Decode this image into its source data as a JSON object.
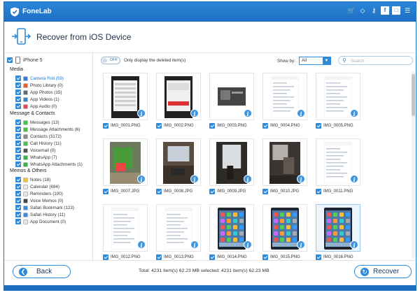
{
  "app": {
    "name": "FoneLab",
    "header_title": "Recover from iOS Device",
    "accent_color": "#2f8bd8",
    "titlebar_icons": [
      "cart-icon",
      "diamond-icon",
      "key-icon",
      "facebook-icon",
      "chat-icon",
      "menu-icon"
    ]
  },
  "sidebar": {
    "device": "iPhone 5",
    "sections": [
      {
        "title": "Media",
        "items": [
          {
            "label": "Camera Roll (59)",
            "color": "#3a7bd5",
            "active": true
          },
          {
            "label": "Photo Library (0)",
            "color": "#e0603a"
          },
          {
            "label": "App Photos (15)",
            "color": "#5a6b7d"
          },
          {
            "label": "App Videos (1)",
            "color": "#3f80c0"
          },
          {
            "label": "App Audio (0)",
            "color": "#e24b4b"
          }
        ]
      },
      {
        "title": "Message & Contacts",
        "items": [
          {
            "label": "Messages (13)",
            "color": "#4cc24c"
          },
          {
            "label": "Message Attachments (6)",
            "color": "#4cc24c"
          },
          {
            "label": "Contacts (3172)",
            "color": "#8a8a8a"
          },
          {
            "label": "Call History (11)",
            "color": "#4cc24c"
          },
          {
            "label": "Voicemail (0)",
            "color": "#555555"
          },
          {
            "label": "WhatsApp (7)",
            "color": "#35b54a"
          },
          {
            "label": "WhatsApp Attachments (1)",
            "color": "#35b54a"
          }
        ]
      },
      {
        "title": "Memos & Others",
        "items": [
          {
            "label": "Notes (18)",
            "color": "#f2c43c"
          },
          {
            "label": "Calendar (694)",
            "color": "#e7e7e7"
          },
          {
            "label": "Reminders (100)",
            "color": "#e7e7e7"
          },
          {
            "label": "Voice Memos (0)",
            "color": "#444444"
          },
          {
            "label": "Safari Bookmark (123)",
            "color": "#3a8be0"
          },
          {
            "label": "Safari History (11)",
            "color": "#3a8be0"
          },
          {
            "label": "App Document (0)",
            "color": "#e7e7e7"
          }
        ]
      }
    ]
  },
  "toolbar": {
    "toggle_state": "OFF",
    "toggle_label": "Only display the deleted item(s)",
    "show_by_label": "Show by:",
    "show_by_value": "All",
    "search_placeholder": "Search"
  },
  "photos": [
    {
      "name": "IMG_0001.PNG",
      "kind": "settings"
    },
    {
      "name": "IMG_0002.PNG",
      "kind": "red-screen"
    },
    {
      "name": "IMG_0003.PNG",
      "kind": "video"
    },
    {
      "name": "IMG_0004.PNG",
      "kind": "form"
    },
    {
      "name": "IMG_0005.PNG",
      "kind": "form"
    },
    {
      "name": "IMG_0007.JPG",
      "kind": "photo-green"
    },
    {
      "name": "IMG_0008.JPG",
      "kind": "photo-room"
    },
    {
      "name": "IMG_0009.JPG",
      "kind": "photo-window"
    },
    {
      "name": "IMG_0010.JPG",
      "kind": "photo-dark"
    },
    {
      "name": "IMG_0011.PNG",
      "kind": "form"
    },
    {
      "name": "IMG_0012.PNG",
      "kind": "form"
    },
    {
      "name": "IMG_0013.PNG",
      "kind": "form"
    },
    {
      "name": "IMG_0014.PNG",
      "kind": "home"
    },
    {
      "name": "IMG_0015.PNG",
      "kind": "home"
    },
    {
      "name": "IMG_0016.PNG",
      "kind": "home",
      "selected": true
    }
  ],
  "footer": {
    "back_label": "Back",
    "totals_text": "Total: 4231 item(s) 62.23 MB   selected: 4231 item(s) 62.23 MB",
    "recover_label": "Recover"
  }
}
